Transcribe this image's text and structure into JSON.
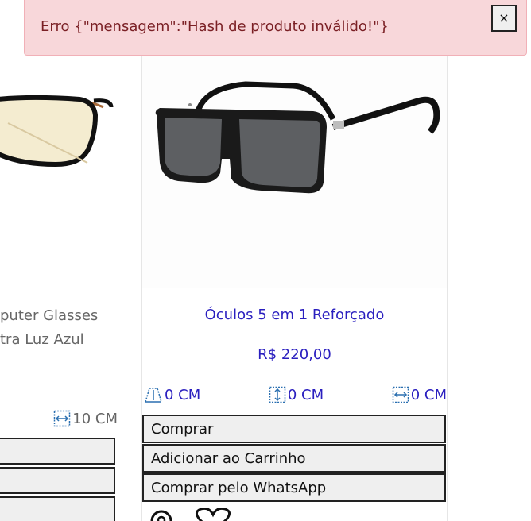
{
  "alert": {
    "message": "Erro {\"mensagem\":\"Hash de produto inválido!\"}",
    "close_label": "×"
  },
  "left_card": {
    "name_line_1": "puter Glasses",
    "name_line_2": "tra Luz Azul",
    "width_value": "10 CM"
  },
  "main_card": {
    "product_name": "Óculos 5 em 1 Reforçado",
    "price": "R$ 220,00",
    "measures": {
      "bridge": "0 CM",
      "height": "0 CM",
      "width": "0 CM"
    },
    "buttons": {
      "buy": "Comprar",
      "add_to_cart": "Adicionar ao Carrinho",
      "buy_whatsapp": "Comprar pelo WhatsApp"
    }
  },
  "colors": {
    "link": "#2a1fbf",
    "alert_bg": "#f8d7da",
    "alert_text": "#7a1f24"
  }
}
